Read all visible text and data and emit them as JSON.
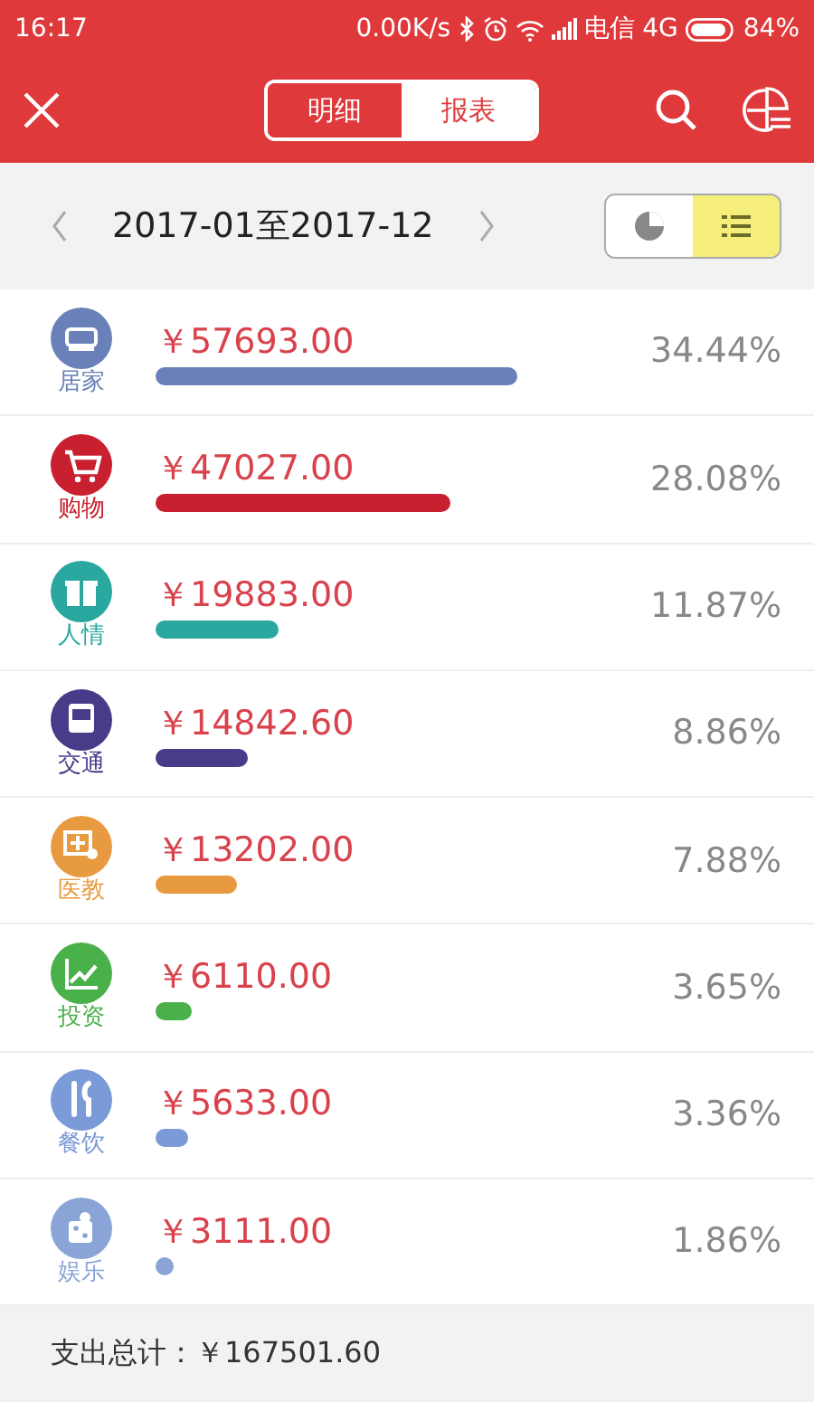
{
  "status_bar": {
    "time": "16:17",
    "speed": "0.00K/s",
    "carrier": "电信",
    "network": "4G",
    "battery": "84%"
  },
  "header": {
    "tabs": [
      {
        "label": "明细",
        "selected": false
      },
      {
        "label": "报表",
        "selected": true
      }
    ]
  },
  "period": {
    "range": "2017-01至2017-12",
    "views": [
      {
        "kind": "pie",
        "selected": false
      },
      {
        "kind": "list",
        "selected": true
      }
    ]
  },
  "categories": [
    {
      "kind": "sofa",
      "name": "居家",
      "amount": "￥57693.00",
      "percent": "34.44%",
      "color": "#6a80b8"
    },
    {
      "kind": "cart",
      "name": "购物",
      "amount": "￥47027.00",
      "percent": "28.08%",
      "color": "#c8202f"
    },
    {
      "kind": "gift",
      "name": "人情",
      "amount": "￥19883.00",
      "percent": "11.87%",
      "color": "#2aa8a0"
    },
    {
      "kind": "bus",
      "name": "交通",
      "amount": "￥14842.60",
      "percent": "8.86%",
      "color": "#4a3a8a"
    },
    {
      "kind": "medical",
      "name": "医教",
      "amount": "￥13202.00",
      "percent": "7.88%",
      "color": "#e89a40"
    },
    {
      "kind": "invest",
      "name": "投资",
      "amount": "￥6110.00",
      "percent": "3.65%",
      "color": "#4ab04a"
    },
    {
      "kind": "food",
      "name": "餐饮",
      "amount": "￥5633.00",
      "percent": "3.36%",
      "color": "#7a9ad8"
    },
    {
      "kind": "dice",
      "name": "娱乐",
      "amount": "￥3111.00",
      "percent": "1.86%",
      "color": "#8aa4d8"
    }
  ],
  "footer": {
    "total": "支出总计：￥167501.60"
  }
}
